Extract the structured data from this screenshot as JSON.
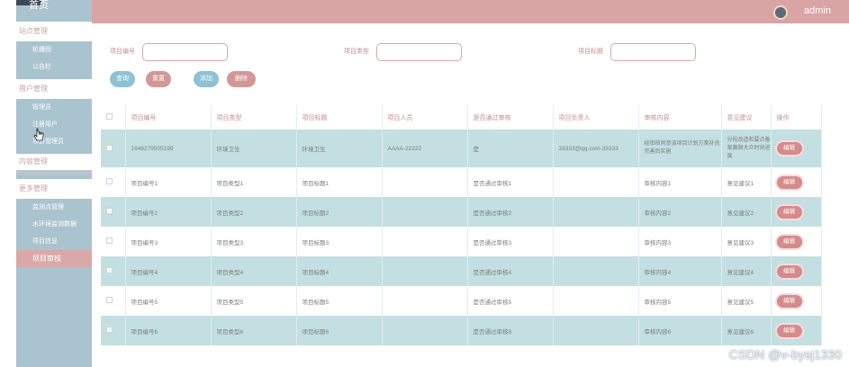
{
  "topbar": {
    "home": "首页",
    "username": "admin"
  },
  "sidebar": {
    "groups": [
      {
        "title": "站点管理",
        "items": [
          "轮播图",
          "公告栏"
        ]
      },
      {
        "title": "用户管理",
        "items": [
          "管理员",
          "注册用户",
          "项目管理员"
        ]
      },
      {
        "title": "内容管理",
        "items": []
      },
      {
        "title": "更多管理",
        "items": [
          "监测点管理",
          "水环境监测数据",
          "项目信息",
          "项目审核"
        ]
      }
    ],
    "active_item": "项目审核"
  },
  "search": {
    "fields": [
      {
        "label": "项目编号",
        "value": ""
      },
      {
        "label": "项目类型",
        "value": ""
      },
      {
        "label": "项目标题",
        "value": ""
      }
    ],
    "buttons": {
      "query": "查询",
      "reset": "重置",
      "add": "添加",
      "delete": "删除"
    }
  },
  "table": {
    "columns": [
      "",
      "项目编号",
      "项目类型",
      "项目标题",
      "项目人员",
      "是否通过审核",
      "项目负责人",
      "审核内容",
      "意见建议",
      "操作"
    ],
    "edit_label": "编辑",
    "rows": [
      [
        "1646279505199",
        "环境卫生",
        "环境卫生",
        "AAAA-22222",
        "是",
        "33333@qq.com-33333",
        "经审核同意该项目计划方案补充完善后实施",
        "分段改造和要点备案兼顾大众时间进度",
        "编辑"
      ],
      [
        "项目编号1",
        "项目类型1",
        "项目标题1",
        "",
        "是否通过审核1",
        "",
        "审核内容1",
        "意见建议1",
        "编辑"
      ],
      [
        "项目编号2",
        "项目类型2",
        "项目标题2",
        "",
        "是否通过审核2",
        "",
        "审核内容2",
        "意见建议2",
        "编辑"
      ],
      [
        "项目编号3",
        "项目类型3",
        "项目标题3",
        "",
        "是否通过审核3",
        "",
        "审核内容3",
        "意见建议3",
        "编辑"
      ],
      [
        "项目编号4",
        "项目类型4",
        "项目标题4",
        "",
        "是否通过审核4",
        "",
        "审核内容4",
        "意见建议4",
        "编辑"
      ],
      [
        "项目编号5",
        "项目类型5",
        "项目标题5",
        "",
        "是否通过审核5",
        "",
        "审核内容5",
        "意见建议5",
        "编辑"
      ],
      [
        "项目编号6",
        "项目类型6",
        "项目标题6",
        "",
        "是否通过审核6",
        "",
        "审核内容6",
        "意见建议6",
        "编辑"
      ]
    ]
  },
  "watermark": "CSDN @v-bysj1330",
  "colors": {
    "accent_rose": "#d9a4a4",
    "accent_teal": "#c3dfe1",
    "sidebar_blue": "#a9c3cf",
    "button_blue": "#8ec1d6"
  }
}
